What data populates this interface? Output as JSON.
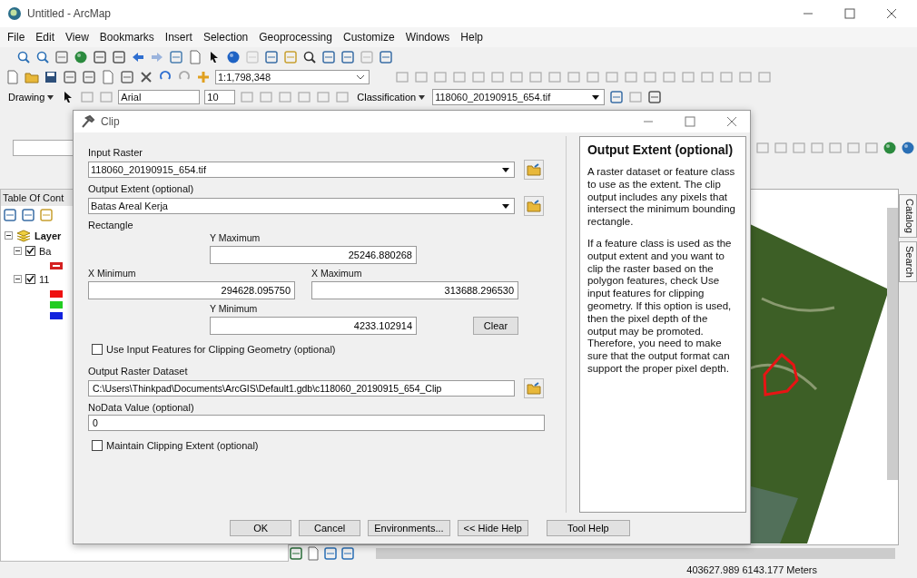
{
  "window": {
    "title": "Untitled - ArcMap"
  },
  "menu": [
    "File",
    "Edit",
    "View",
    "Bookmarks",
    "Insert",
    "Selection",
    "Geoprocessing",
    "Customize",
    "Windows",
    "Help"
  ],
  "standard_toolbar": {
    "scale": "1:1,798,348"
  },
  "drawing_toolbar": {
    "label": "Drawing",
    "font": "Arial",
    "size": "10",
    "classification": "Classification",
    "layer": "118060_20190915_654.tif"
  },
  "toc": {
    "title": "Table Of Cont",
    "items": [
      {
        "label": "Layer",
        "bold": true,
        "expanded": true,
        "children": [
          {
            "label": "Ba",
            "checked": true,
            "expanded": true,
            "legend": [
              {
                "kind": "outline",
                "color": "#d42020"
              }
            ]
          },
          {
            "label": "11",
            "checked": true,
            "expanded": true,
            "legend": [
              {
                "kind": "fill",
                "color": "#ee1111"
              },
              {
                "kind": "fill",
                "color": "#22cc22"
              },
              {
                "kind": "fill",
                "color": "#1122dd"
              }
            ]
          }
        ]
      }
    ]
  },
  "side_tabs": [
    "Catalog",
    "Search"
  ],
  "status_bar": {
    "coordinates": "403627.989  6143.177 Meters"
  },
  "dialog": {
    "title": "Clip",
    "params": [
      {
        "kind": "dropdown",
        "label": "Input Raster",
        "value": "118060_20190915_654.tif"
      },
      {
        "kind": "dropdown",
        "label": "Output Extent (optional)",
        "value": "Batas Areal Kerja"
      },
      {
        "kind": "rectangle",
        "label": "Rectangle",
        "y_max_label": "Y Maximum",
        "y_max": "25246.880268",
        "x_min_label": "X Minimum",
        "x_min": "294628.095750",
        "x_max_label": "X Maximum",
        "x_max": "313688.296530",
        "y_min_label": "Y Minimum",
        "y_min": "4233.102914",
        "clear": "Clear"
      },
      {
        "kind": "checkbox",
        "label": "Use Input Features for Clipping Geometry (optional)",
        "checked": false
      },
      {
        "kind": "path",
        "label": "Output Raster Dataset",
        "value": "C:\\Users\\Thinkpad\\Documents\\ArcGIS\\Default1.gdb\\c118060_20190915_654_Clip"
      },
      {
        "kind": "text",
        "label": "NoData Value (optional)",
        "value": "0"
      },
      {
        "kind": "checkbox",
        "label": "Maintain Clipping Extent (optional)",
        "checked": false
      }
    ],
    "help": {
      "title": "Output Extent (optional)",
      "paragraphs": [
        "A raster dataset or feature class to use as the extent. The clip output includes any pixels that intersect the minimum bounding rectangle.",
        "If a feature class is used as the output extent and you want to clip the raster based on the polygon features, check Use input features for clipping geometry. If this option is used, then the pixel depth of the output may be promoted. Therefore, you need to make sure that the output format can support the proper pixel depth."
      ]
    },
    "buttons": [
      "OK",
      "Cancel",
      "Environments...",
      "<< Hide Help",
      "Tool Help"
    ]
  }
}
